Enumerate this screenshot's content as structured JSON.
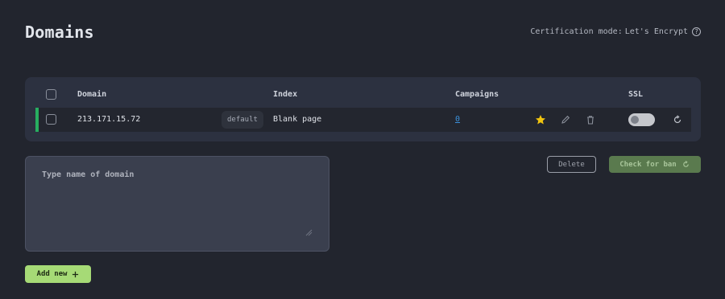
{
  "page": {
    "title": "Domains"
  },
  "certification": {
    "label": "Certification mode:",
    "value": "Let's Encrypt",
    "help_icon": "help-circle-icon"
  },
  "table": {
    "headers": {
      "domain": "Domain",
      "index": "Index",
      "campaigns": "Campaigns",
      "ssl": "SSL"
    },
    "rows": [
      {
        "domain": "213.171.15.72",
        "badge": "default",
        "index": "Blank page",
        "campaigns": "0",
        "favorite": true,
        "ssl_enabled": false,
        "accent_color": "#27ae60"
      }
    ]
  },
  "domain_input": {
    "placeholder": "Type name of domain",
    "value": ""
  },
  "actions": {
    "delete_label": "Delete",
    "check_ban_label": "Check for ban",
    "add_new_label": "Add new",
    "add_icon": "plus-icon",
    "check_icon": "refresh-icon"
  },
  "colors": {
    "background": "#22252e",
    "card": "#2c3140",
    "accent_green": "#a6da76",
    "star": "#f1c40f",
    "link": "#3b8fd9"
  }
}
